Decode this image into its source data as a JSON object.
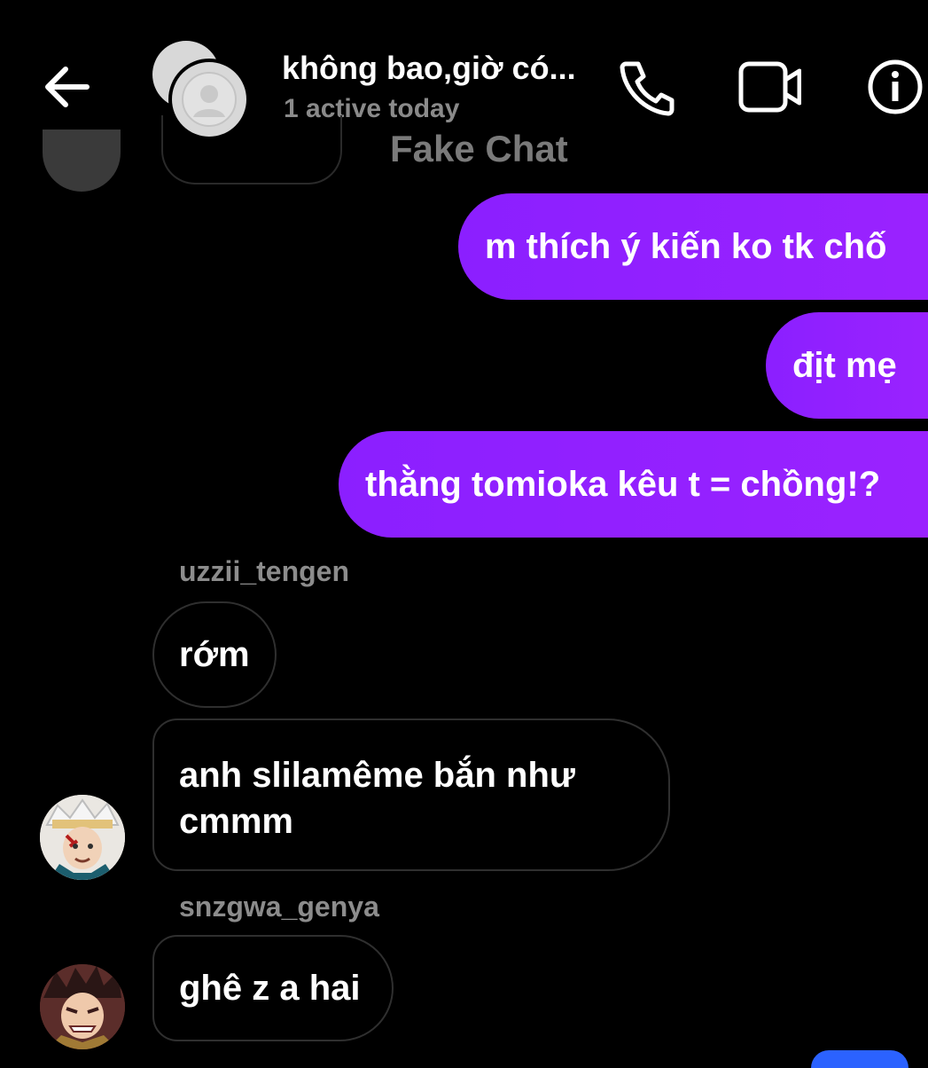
{
  "header": {
    "back_label": "back",
    "title": "không bao,giờ có...",
    "subtitle": "1 active today",
    "watermark": "Fake Chat",
    "icons": [
      "arrow-left-icon",
      "phone-icon",
      "video-camera-icon",
      "info-icon"
    ]
  },
  "messages": {
    "outgoing": [
      "m thích ý kiến ko tk chố",
      "địt mẹ",
      "thằng tomioka kêu t = chồng!?"
    ],
    "incoming": [
      {
        "sender": "uzzii_tengen",
        "text": "rớm"
      },
      {
        "sender": "",
        "text": "anh slilamême bắn như cmmm"
      },
      {
        "sender": "snzgwa_genya",
        "text": "ghê z a hai"
      }
    ]
  },
  "colors": {
    "background": "#000000",
    "outgoing_bubble": "#8b1fff",
    "incoming_border": "#2f2f2f",
    "secondary_text": "#8a8a8a"
  }
}
